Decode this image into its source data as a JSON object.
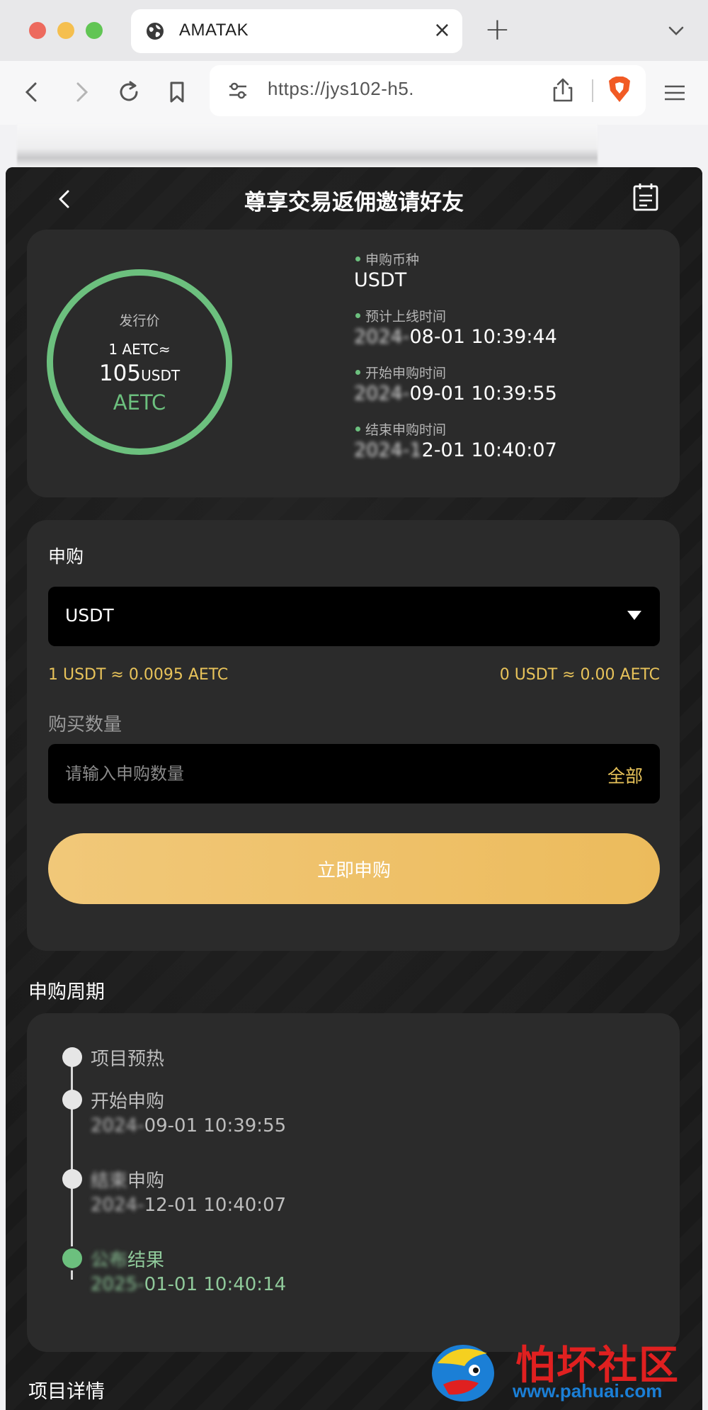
{
  "browser": {
    "tab_title": "AMATAK",
    "tab_close": "×",
    "new_tab": "+",
    "url": "https://jys102-h5."
  },
  "app": {
    "title": "尊享交易返佣邀请好友",
    "issue": {
      "label": "发行价",
      "rate": "1 AETC≈",
      "price_num": "105",
      "price_unit": "USDT",
      "coin": "AETC"
    },
    "info": [
      {
        "label": "申购币种",
        "value_hidden": "",
        "value": "USDT"
      },
      {
        "label": "预计上线时间",
        "value_hidden": "2024-",
        "value": "08-01 10:39:44"
      },
      {
        "label": "开始申购时间",
        "value_hidden": "2024-",
        "value": "09-01 10:39:55"
      },
      {
        "label": "结束申购时间",
        "value_hidden": "2024-1",
        "value": "2-01 10:40:07"
      }
    ],
    "subscribe": {
      "title": "申购",
      "currency": "USDT",
      "rate_left": "1 USDT ≈ 0.0095 AETC",
      "rate_right": "0 USDT ≈ 0.00 AETC",
      "qty_label": "购买数量",
      "qty_placeholder": "请输入申购数量",
      "qty_all": "全部",
      "buy_button": "立即申购"
    },
    "period": {
      "title": "申购周期",
      "steps": [
        {
          "name": "项目预热",
          "name_hidden": "",
          "date_hidden": "",
          "date": ""
        },
        {
          "name": "开始申购",
          "name_hidden": "",
          "date_hidden": "2024-",
          "date": "09-01 10:39:55"
        },
        {
          "name": "申购",
          "name_hidden": "结束",
          "date_hidden": "2024-",
          "date": "12-01 10:40:07"
        },
        {
          "name": "结果",
          "name_hidden": "公布",
          "date_hidden": "2025-",
          "date": "01-01 10:40:14"
        }
      ]
    },
    "details_title": "项目详情"
  },
  "watermark": {
    "text": "怕坏社区",
    "url": "www.pahuai.com"
  },
  "colors": {
    "accent_green": "#6cc07e",
    "accent_gold": "#e8c35a",
    "card_bg": "#2b2b2b",
    "watermark_red": "#e02020",
    "watermark_blue": "#1b7fd6"
  }
}
